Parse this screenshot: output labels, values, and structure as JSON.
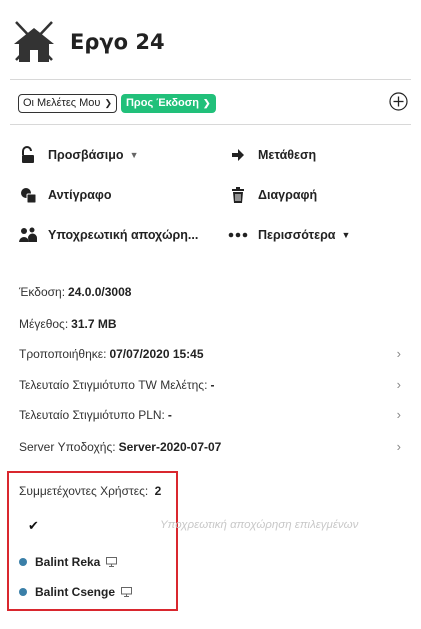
{
  "header": {
    "title": "Εργο 24"
  },
  "filters": {
    "studies_select": "Οι Μελέτες Μου",
    "status_chip": "Προς Έκδοση"
  },
  "actions": {
    "accessible": "Προσβάσιμο",
    "move": "Μετάθεση",
    "copy": "Αντίγραφο",
    "delete": "Διαγραφή",
    "mandatory_release": "Υποχρεωτική αποχώρη...",
    "more": "Περισσότερα"
  },
  "info": {
    "version_label": "Έκδοση:",
    "version_value": "24.0.0/3008",
    "size_label": "Μέγεθος:",
    "size_value": "31.7 MB",
    "modified_label": "Τροποποιήθηκε:",
    "modified_value": "07/07/2020 15:45",
    "tw_snapshot_label": "Τελευταίο Στιγμιότυπο TW Μελέτης:",
    "tw_snapshot_value": "-",
    "pln_snapshot_label": "Τελευταίο Στιγμιότυπο PLN:",
    "pln_snapshot_value": "-",
    "server_label": "Server Υποδοχής:",
    "server_value": "Server-2020-07-07"
  },
  "users": {
    "title_label": "Συμμετέχοντες Χρήστες:",
    "count": "2",
    "ghost_action": "Υποχρεωτική αποχώρηση επιλεγμένων",
    "list": [
      {
        "name": "Balint Reka"
      },
      {
        "name": "Balint Csenge"
      }
    ]
  },
  "colors": {
    "accent_green": "#21c07a",
    "highlight_red": "#d9272e",
    "user_dot": "#3a7fa8"
  }
}
